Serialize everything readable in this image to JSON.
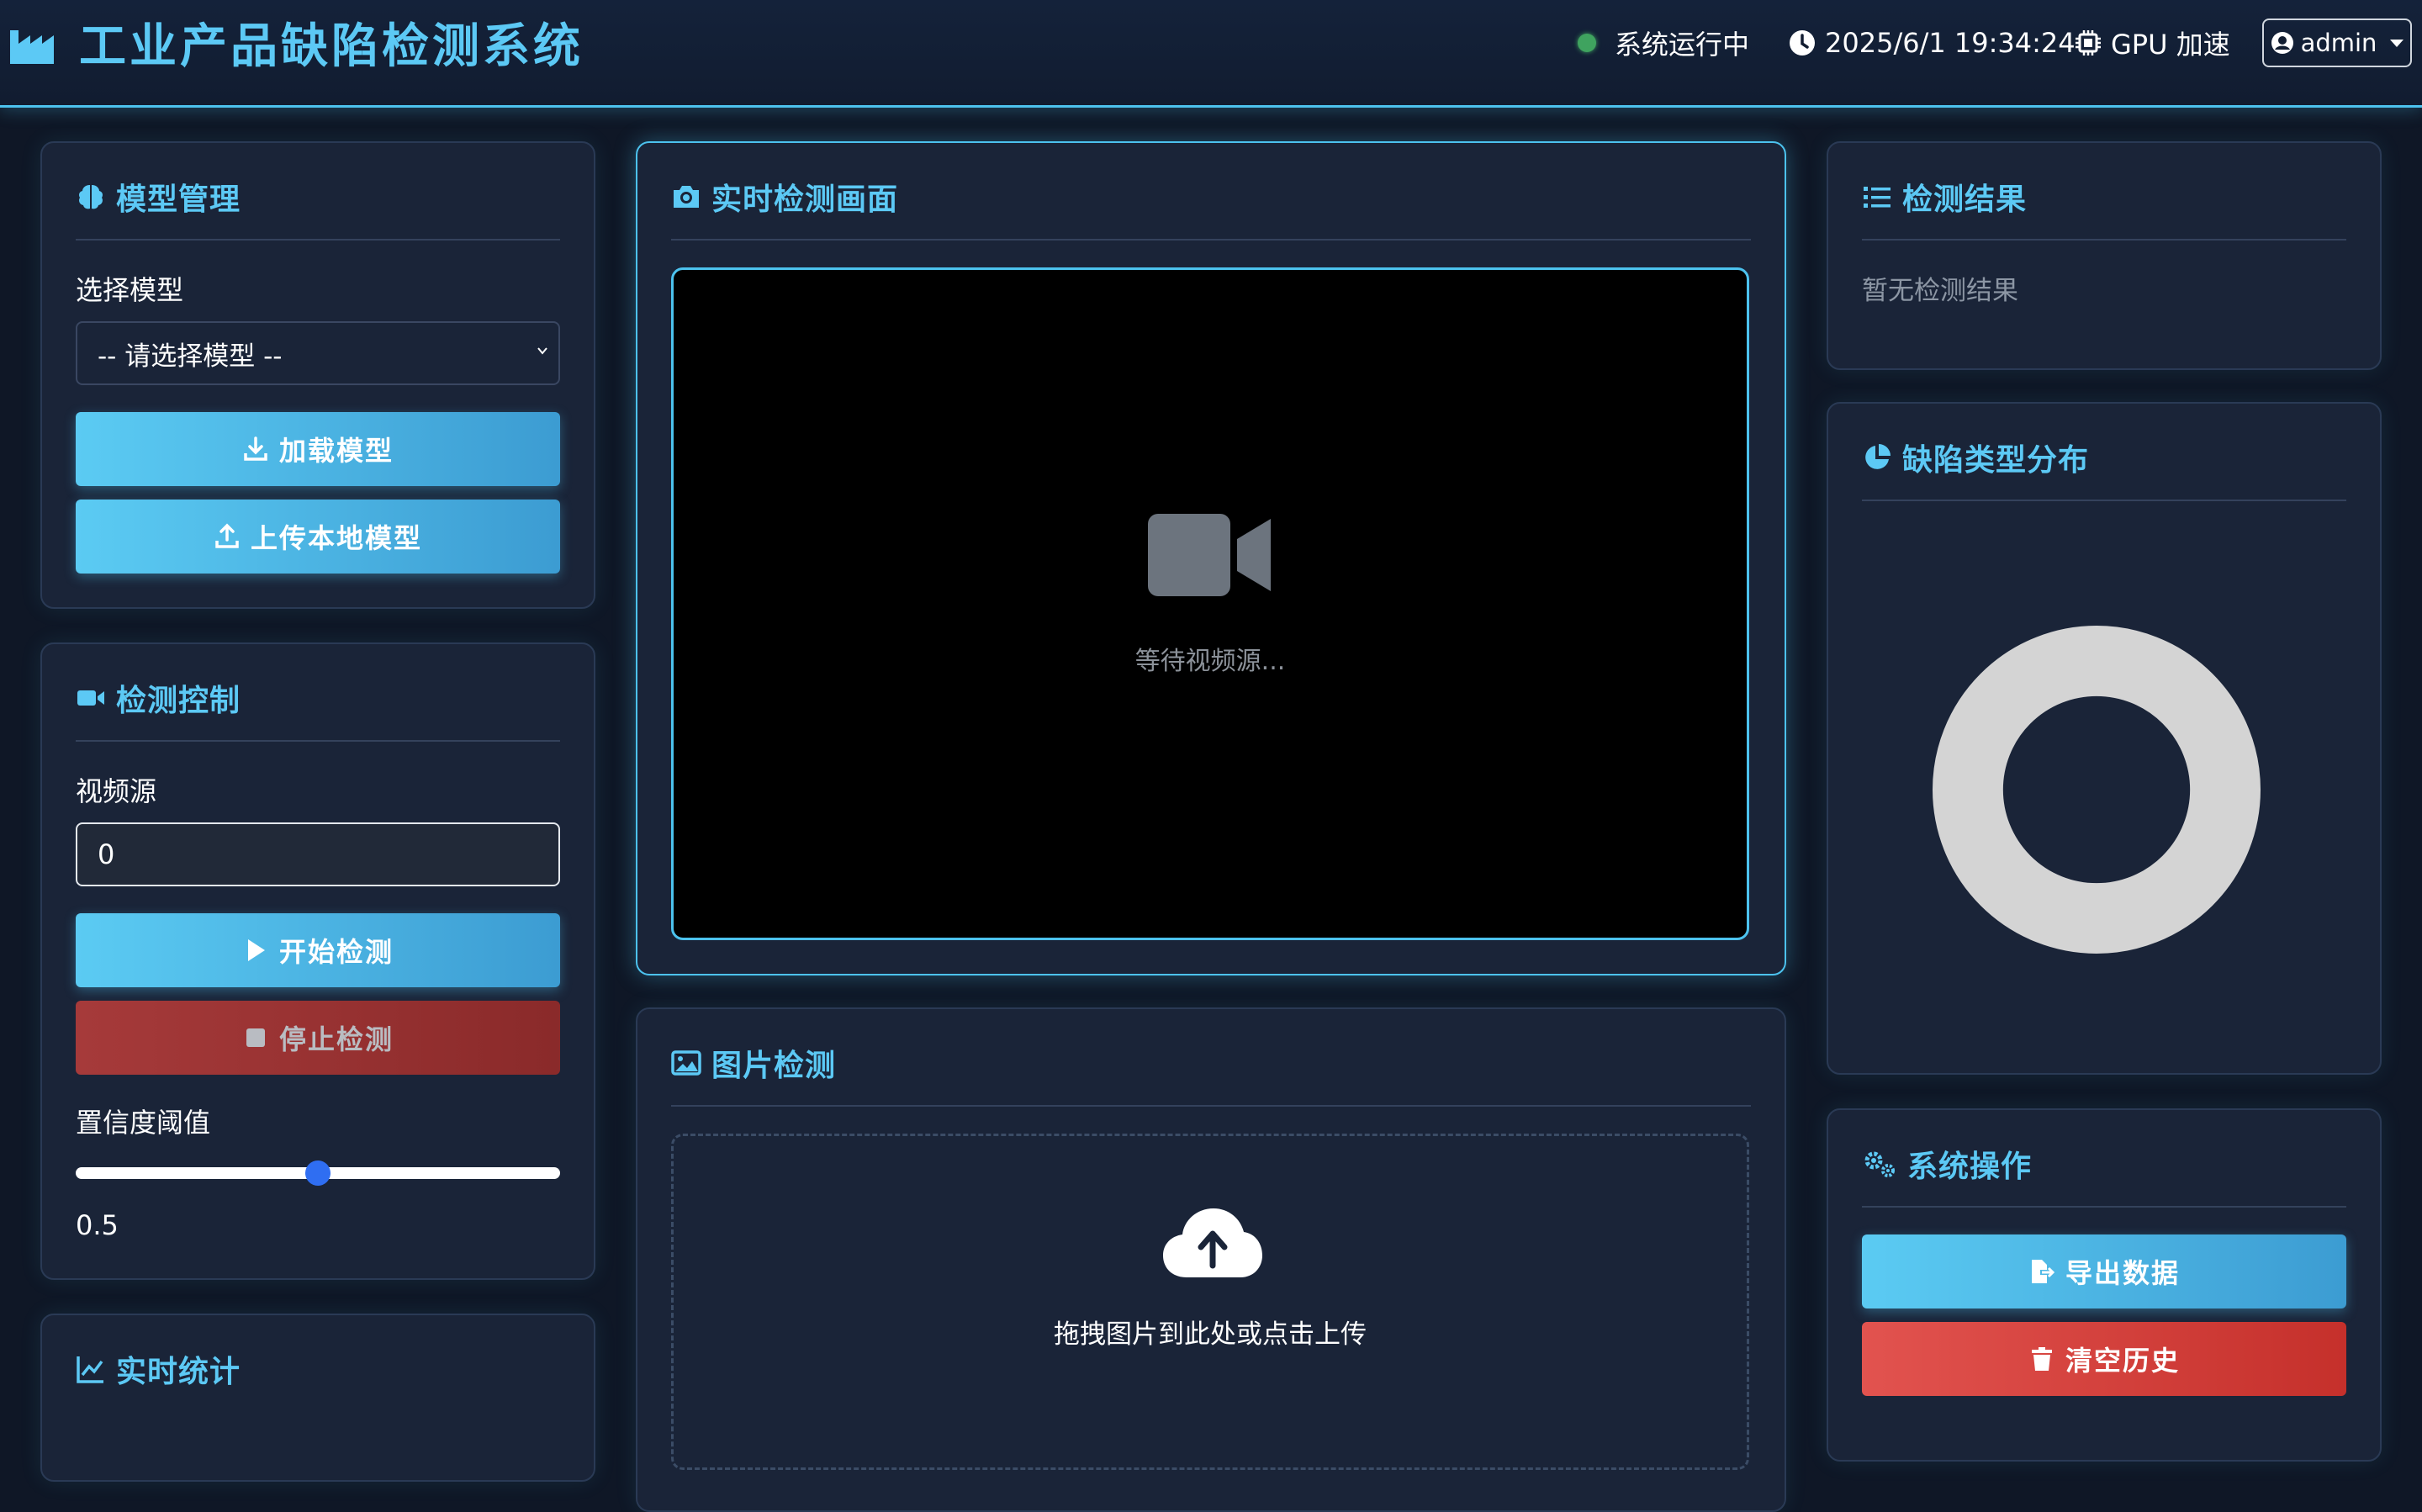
{
  "header": {
    "title": "工业产品缺陷检测系统",
    "status_text": "系统运行中",
    "datetime": "2025/6/1 19:34:24",
    "gpu_text": "GPU 加速",
    "user": "admin",
    "icons": [
      "factory-icon",
      "clock-icon",
      "chip-icon",
      "user-circle-icon"
    ],
    "status_color": "#3fa35f"
  },
  "model_panel": {
    "title": "模型管理",
    "select_label": "选择模型",
    "select_value": "-- 请选择模型 --",
    "load_button": "加载模型",
    "upload_button": "上传本地模型"
  },
  "control_panel": {
    "title": "检测控制",
    "source_label": "视频源",
    "source_value": "0",
    "start_button": "开始检测",
    "stop_button": "停止检测",
    "threshold_label": "置信度阈值",
    "threshold_value": "0.5",
    "threshold_fraction": 0.5
  },
  "stats_panel": {
    "title": "实时统计"
  },
  "video_panel": {
    "title": "实时检测画面",
    "waiting_text": "等待视频源..."
  },
  "image_panel": {
    "title": "图片检测",
    "drop_text": "拖拽图片到此处或点击上传"
  },
  "results_panel": {
    "title": "检测结果",
    "empty_text": "暂无检测结果"
  },
  "distribution_panel": {
    "title": "缺陷类型分布"
  },
  "operations_panel": {
    "title": "系统操作",
    "export_button": "导出数据",
    "clear_button": "清空历史"
  },
  "colors": {
    "accent": "#5cc9f5",
    "background": "#0f1726",
    "card": "#1a2438",
    "danger": "#e2534f",
    "donut": "#d4d4d4"
  }
}
